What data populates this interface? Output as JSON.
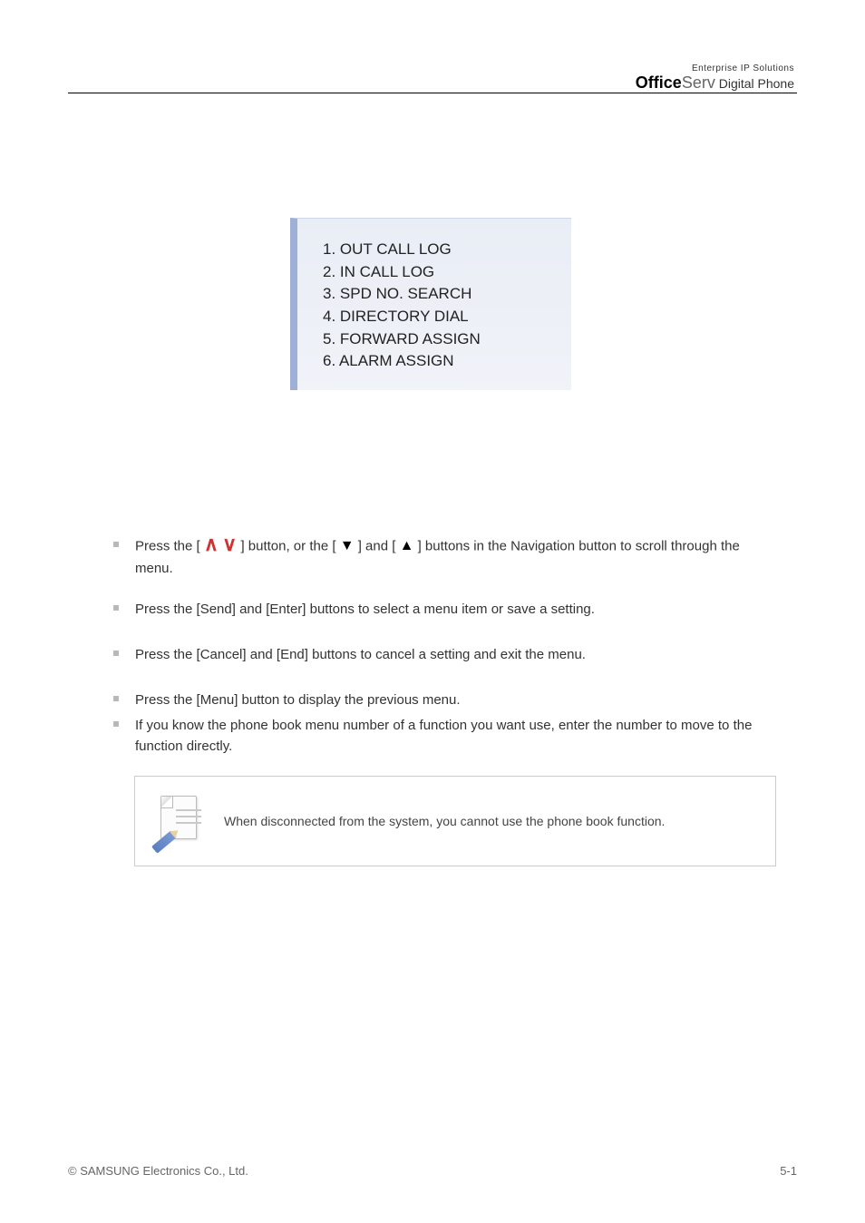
{
  "brand": {
    "tagline": "Enterprise IP Solutions",
    "name_bold": "Office",
    "name_light": "Serv",
    "name_sub": " Digital Phone"
  },
  "menu": {
    "items": [
      {
        "label": "1. OUT CALL LOG"
      },
      {
        "label": "2. IN CALL LOG"
      },
      {
        "label": "3. SPD NO. SEARCH"
      },
      {
        "label": "4. DIRECTORY DIAL"
      },
      {
        "label": "5. FORWARD ASSIGN"
      },
      {
        "label": "6. ALARM ASSIGN"
      }
    ]
  },
  "bullets": {
    "b1_pre": "Press the [",
    "b1_mid": "] button, or the [",
    "b1_mid2": "] and [",
    "b1_post": "] buttons in the Navigation button to scroll through the menu.",
    "b2": "Press the [Send] and [Enter] buttons to select a menu item or save a setting.",
    "b3": "Press the [Cancel] and [End] buttons to cancel a setting and exit the menu.",
    "b4": "Press the [Menu] button to display the previous menu.",
    "b5": "If you know the phone book menu number of a function you want use, enter the number to move to the function directly."
  },
  "note": {
    "text": "When disconnected from the system, you cannot use the phone book function."
  },
  "footer": {
    "copyright": "© SAMSUNG Electronics Co., Ltd.",
    "page": "5-1"
  }
}
